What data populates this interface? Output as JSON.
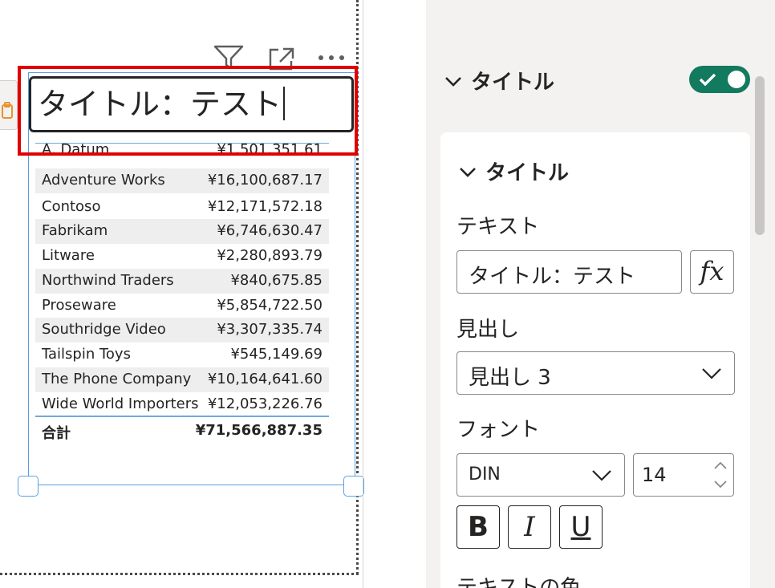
{
  "visual": {
    "title_text": "タイトル：テスト",
    "rows": [
      {
        "name": "A. Datum",
        "value": "¥1,501,351.61"
      },
      {
        "name": "Adventure Works",
        "value": "¥16,100,687.17"
      },
      {
        "name": "Contoso",
        "value": "¥12,171,572.18"
      },
      {
        "name": "Fabrikam",
        "value": "¥6,746,630.47"
      },
      {
        "name": "Litware",
        "value": "¥2,280,893.79"
      },
      {
        "name": "Northwind Traders",
        "value": "¥840,675.85"
      },
      {
        "name": "Proseware",
        "value": "¥5,854,722.50"
      },
      {
        "name": "Southridge Video",
        "value": "¥3,307,335.74"
      },
      {
        "name": "Tailspin Toys",
        "value": "¥545,149.69"
      },
      {
        "name": "The Phone Company",
        "value": "¥10,164,641.60"
      },
      {
        "name": "Wide World Importers",
        "value": "¥12,053,226.76"
      }
    ],
    "total": {
      "name": "合計",
      "value": "¥71,566,887.35"
    },
    "header_icons": [
      "filter-icon",
      "focus-mode-icon",
      "more-options-icon"
    ]
  },
  "format_pane": {
    "section_title": "タイトル",
    "section_enabled": true,
    "subsection_title": "タイトル",
    "text_label": "テキスト",
    "text_value": "タイトル：テスト",
    "fx_label": "fx",
    "heading_label": "見出し",
    "heading_value": "見出し 3",
    "font_label": "フォント",
    "font_family_value": "DIN",
    "font_size_value": "14",
    "bold_label": "B",
    "italic_label": "I",
    "underline_label": "U",
    "text_color_label": "テキストの色"
  },
  "colors": {
    "highlight": "#e00000",
    "toggle_on": "#127a5e",
    "selection": "#5aa0e0"
  }
}
